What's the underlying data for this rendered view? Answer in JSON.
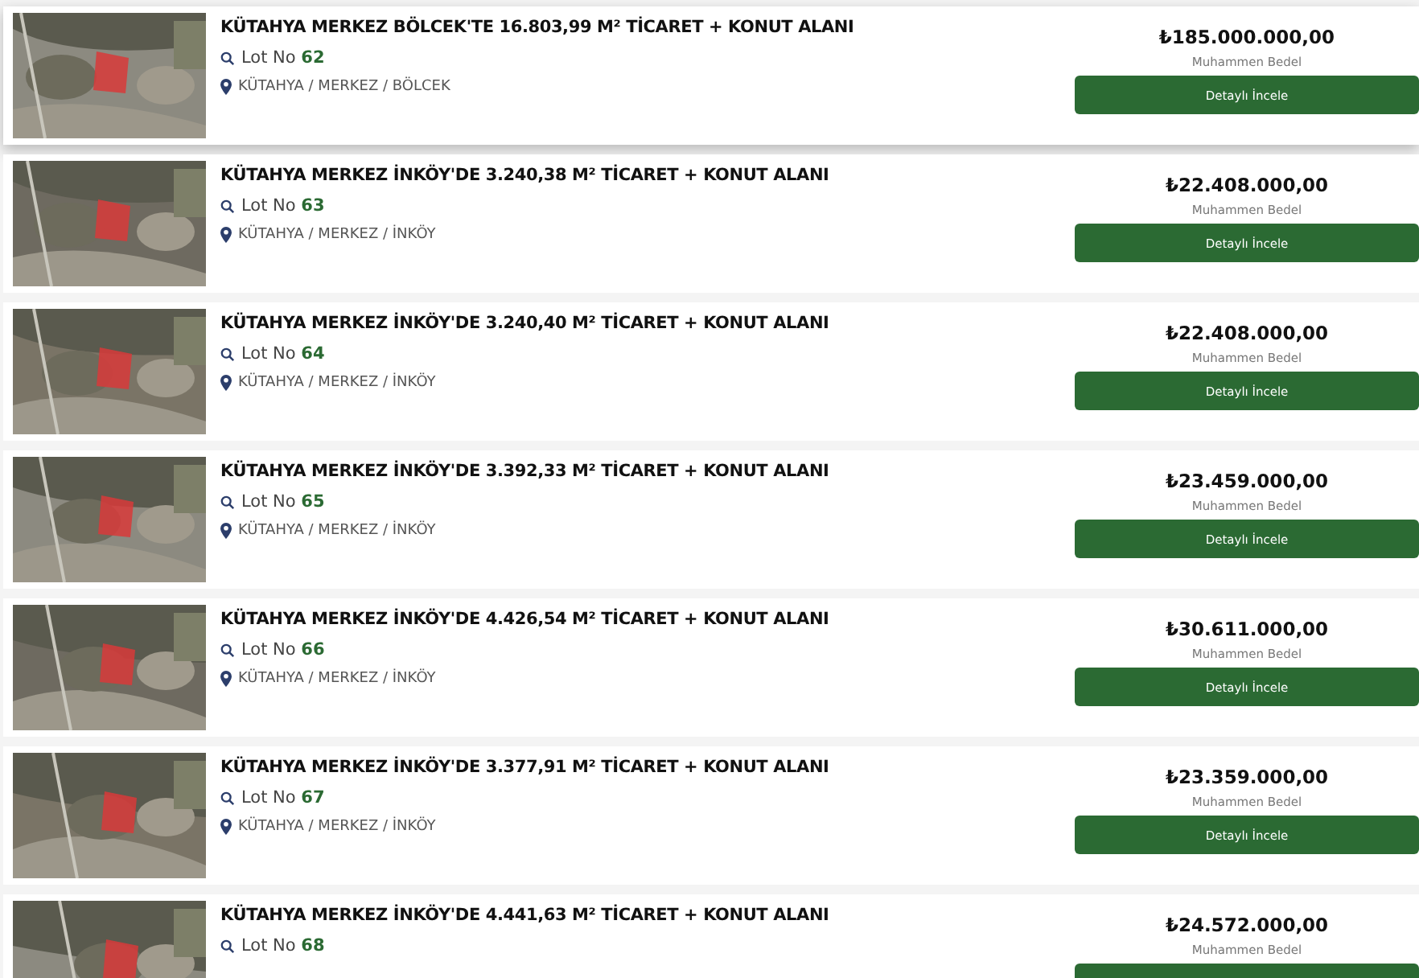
{
  "listings": [
    {
      "title": "KÜTAHYA MERKEZ BÖLCEK'TE 16.803,99 M² TİCARET + KONUT ALANI",
      "lot_label": "Lot No",
      "lot": "62",
      "location": "KÜTAHYA / MERKEZ / BÖLCEK",
      "price": "₺185.000.000,00",
      "price_label": "Muhammen Bedel",
      "button": "Detaylı İncele",
      "hovered": true
    },
    {
      "title": "KÜTAHYA MERKEZ İNKÖY'DE 3.240,38 M² TİCARET + KONUT ALANI",
      "lot_label": "Lot No",
      "lot": "63",
      "location": "KÜTAHYA / MERKEZ / İNKÖY",
      "price": "₺22.408.000,00",
      "price_label": "Muhammen Bedel",
      "button": "Detaylı İncele",
      "hovered": false
    },
    {
      "title": "KÜTAHYA MERKEZ İNKÖY'DE 3.240,40 M² TİCARET + KONUT ALANI",
      "lot_label": "Lot No",
      "lot": "64",
      "location": "KÜTAHYA / MERKEZ / İNKÖY",
      "price": "₺22.408.000,00",
      "price_label": "Muhammen Bedel",
      "button": "Detaylı İncele",
      "hovered": false
    },
    {
      "title": "KÜTAHYA MERKEZ İNKÖY'DE 3.392,33 M² TİCARET + KONUT ALANI",
      "lot_label": "Lot No",
      "lot": "65",
      "location": "KÜTAHYA / MERKEZ / İNKÖY",
      "price": "₺23.459.000,00",
      "price_label": "Muhammen Bedel",
      "button": "Detaylı İncele",
      "hovered": false
    },
    {
      "title": "KÜTAHYA MERKEZ İNKÖY'DE 4.426,54 M² TİCARET + KONUT ALANI",
      "lot_label": "Lot No",
      "lot": "66",
      "location": "KÜTAHYA / MERKEZ / İNKÖY",
      "price": "₺30.611.000,00",
      "price_label": "Muhammen Bedel",
      "button": "Detaylı İncele",
      "hovered": false
    },
    {
      "title": "KÜTAHYA MERKEZ İNKÖY'DE 3.377,91 M² TİCARET + KONUT ALANI",
      "lot_label": "Lot No",
      "lot": "67",
      "location": "KÜTAHYA / MERKEZ / İNKÖY",
      "price": "₺23.359.000,00",
      "price_label": "Muhammen Bedel",
      "button": "Detaylı İncele",
      "hovered": false
    },
    {
      "title": "KÜTAHYA MERKEZ İNKÖY'DE 4.441,63 M² TİCARET + KONUT ALANI",
      "lot_label": "Lot No",
      "lot": "68",
      "price": "₺24.572.000,00",
      "price_label": "Muhammen Bedel",
      "hovered": false
    }
  ]
}
